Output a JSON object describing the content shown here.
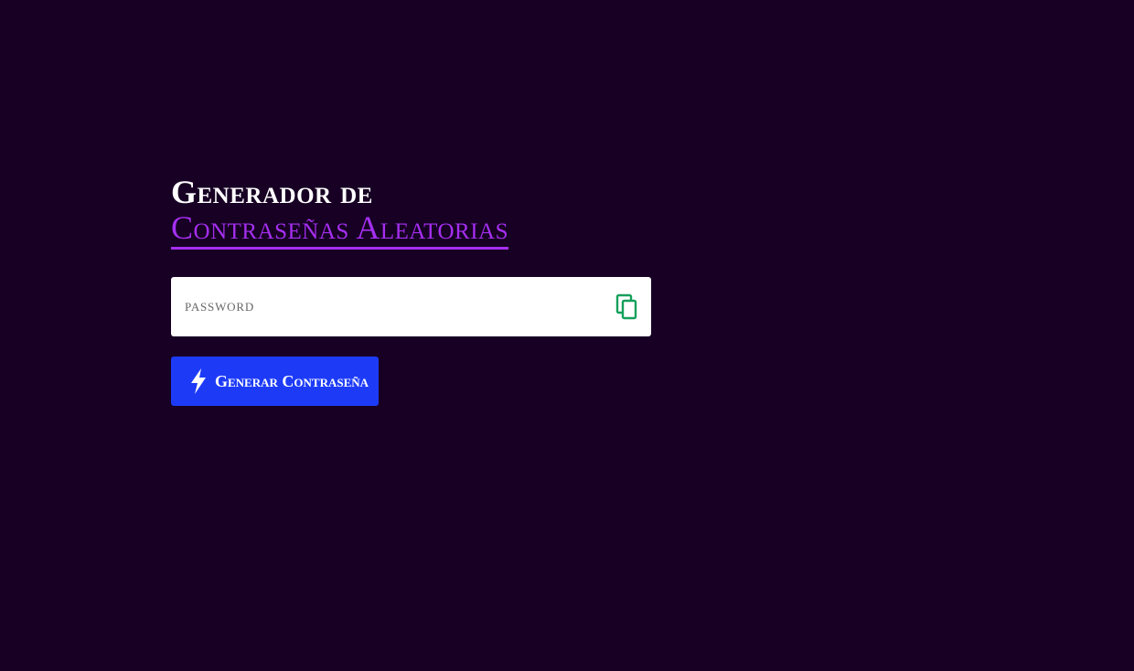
{
  "header": {
    "title_line1": "Generador de",
    "title_line2": "Contraseñas Aleatorias"
  },
  "password_field": {
    "value": "",
    "placeholder": "PASSWORD",
    "copy_icon": "copy-icon"
  },
  "generate_button": {
    "label": "Generar Contraseña",
    "icon": "lightning-bolt-icon"
  },
  "colors": {
    "background": "#170024",
    "accent_purple": "#a52ff0",
    "button_blue": "#1d3bf7",
    "copy_icon_green": "#14a05a"
  }
}
